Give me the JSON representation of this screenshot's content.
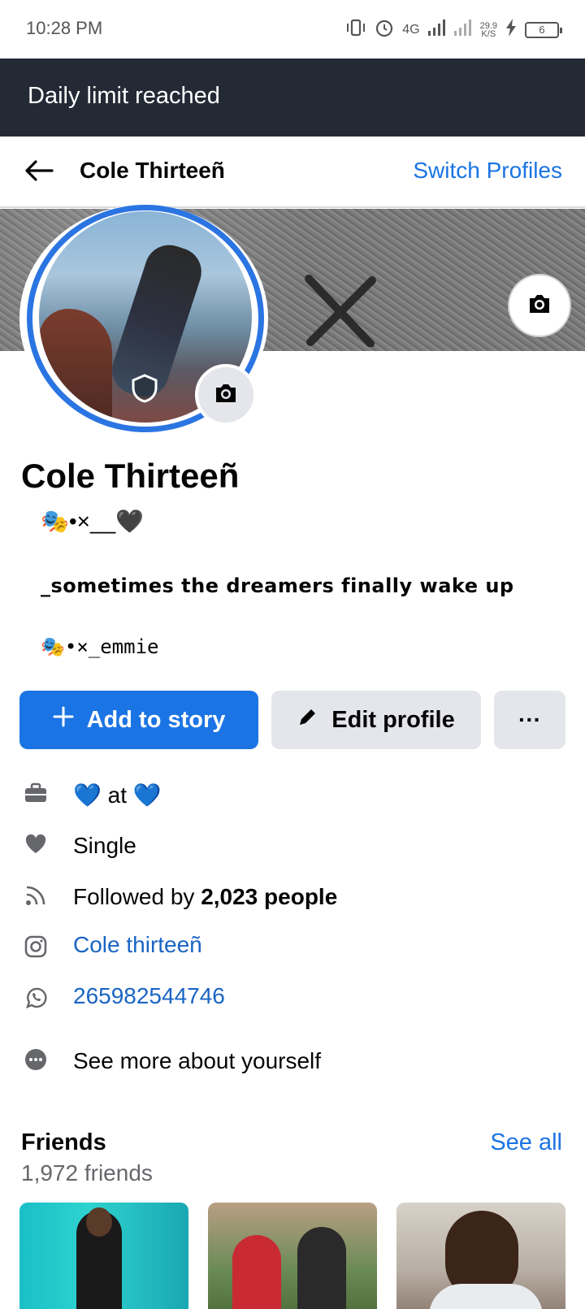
{
  "status_bar": {
    "time": "10:28 PM",
    "network": "4G",
    "speed_value": "29.9",
    "speed_unit": "K/S",
    "battery": "6"
  },
  "banner": {
    "text": "Daily limit reached"
  },
  "nav": {
    "title": "Cole Thirteeñ",
    "switch_label": "Switch Profiles"
  },
  "profile": {
    "name": "Cole Thirteeñ",
    "bio_line1": "🎭•×__🖤",
    "bio_line2": "_sometimes the dreamers finally wake up",
    "bio_line3": "🎭•×_emmie"
  },
  "actions": {
    "add_story": "Add to story",
    "edit_profile": "Edit profile",
    "more": "···"
  },
  "details": {
    "work": "💙 at 💙",
    "relationship": "Single",
    "followed_prefix": "Followed by ",
    "followed_count": "2,023 people",
    "instagram": "Cole thirteeñ",
    "whatsapp": "265982544746",
    "see_more": "See more about yourself"
  },
  "friends": {
    "title": "Friends",
    "see_all": "See all",
    "count": "1,972 friends"
  },
  "colors": {
    "accent": "#1b74e4",
    "banner_bg": "#242a35",
    "button_gray": "#e4e6eb",
    "link": "#1a64c4"
  }
}
